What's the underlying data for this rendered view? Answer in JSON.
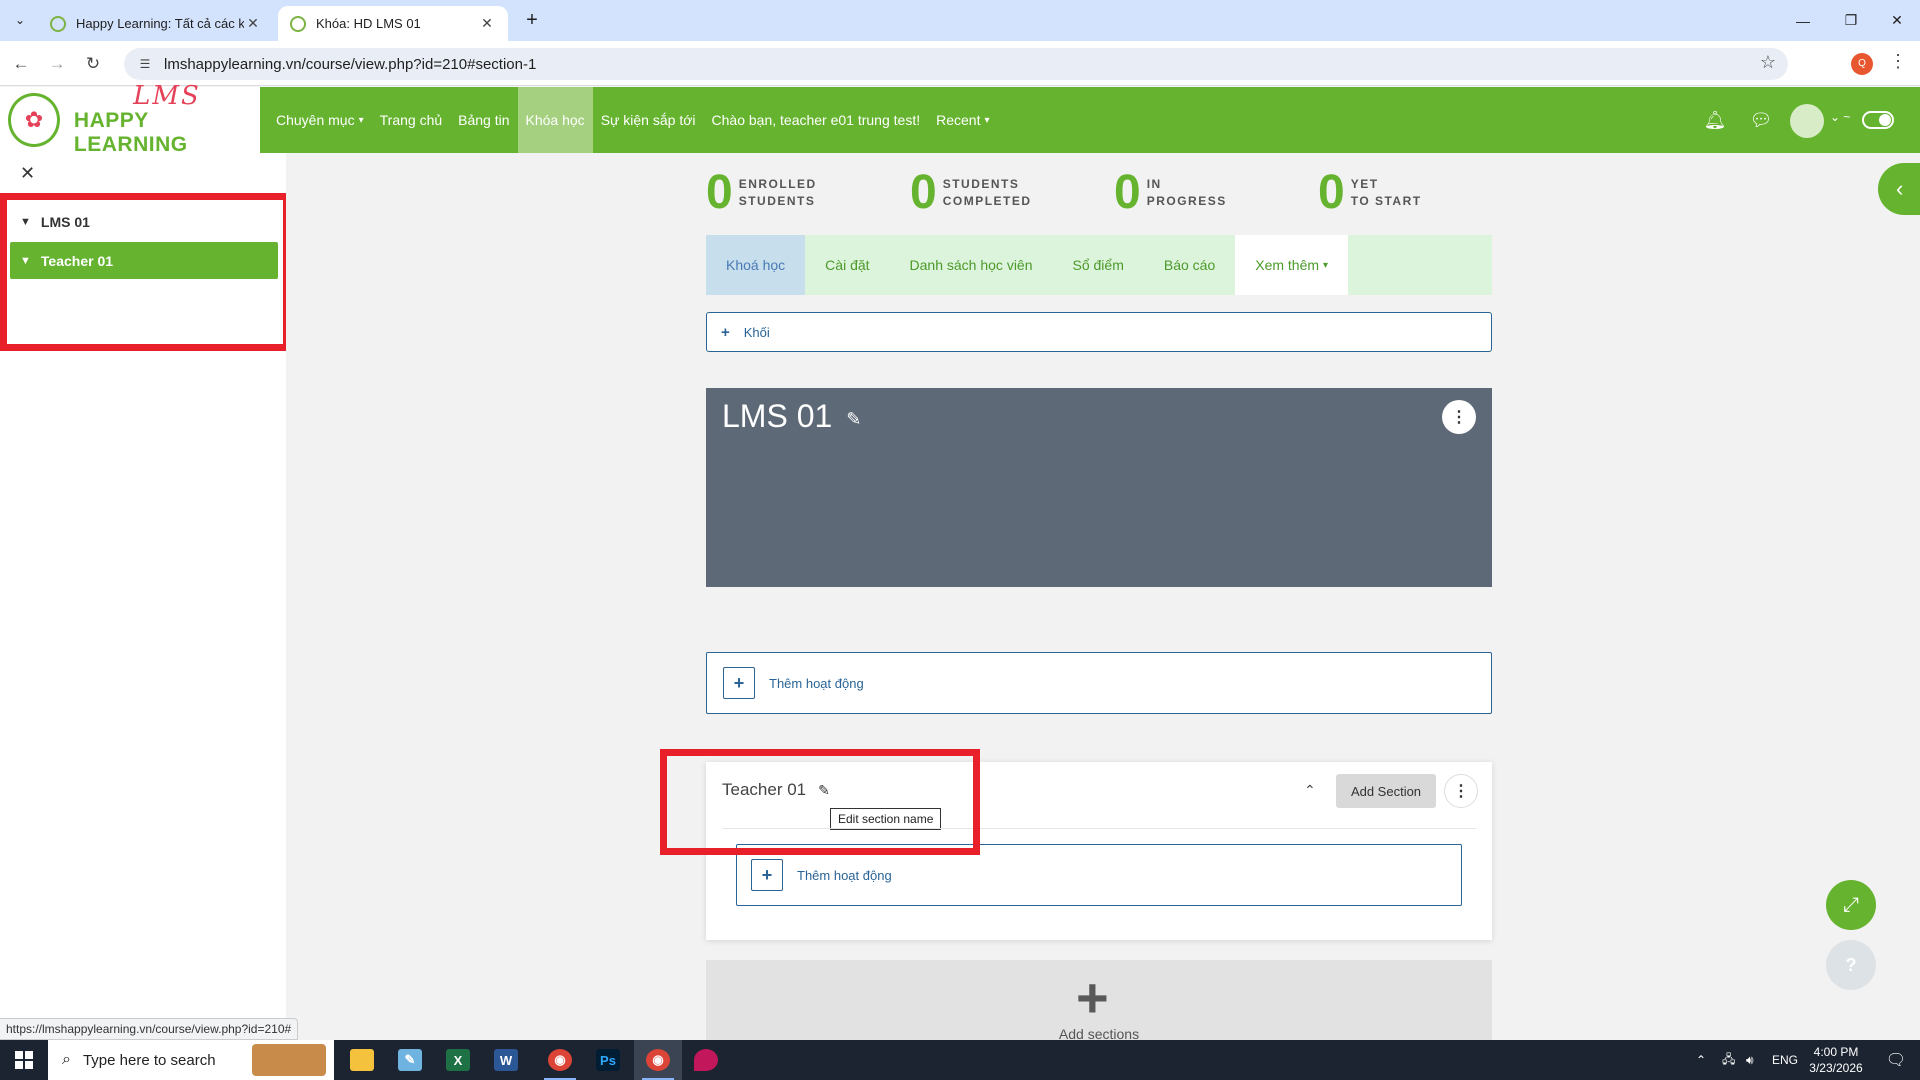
{
  "browser": {
    "tabs": [
      {
        "title": "Happy Learning: Tất cả các khoá",
        "active": false
      },
      {
        "title": "Khóa: HD LMS 01",
        "active": true
      }
    ],
    "url": "lmshappylearning.vn/course/view.php?id=210#section-1",
    "status_url": "https://lmshappylearning.vn/course/view.php?id=210#",
    "profile_initial": "Q"
  },
  "site": {
    "logo_lms": "LMS",
    "logo_name": "HAPPY LEARNING",
    "nav": [
      {
        "label": "Chuyên mục",
        "dropdown": true
      },
      {
        "label": "Trang chủ"
      },
      {
        "label": "Bảng tin"
      },
      {
        "label": "Khóa học",
        "active": true
      },
      {
        "label": "Sự kiện sắp tới"
      },
      {
        "label": "Chào bạn, teacher e01 trung test!"
      },
      {
        "label": "Recent",
        "dropdown": true
      }
    ]
  },
  "drawer": {
    "items": [
      {
        "label": "LMS 01",
        "active": false
      },
      {
        "label": "Teacher 01",
        "active": true
      }
    ]
  },
  "stats": [
    {
      "value": "0",
      "line1": "ENROLLED",
      "line2": "STUDENTS"
    },
    {
      "value": "0",
      "line1": "STUDENTS",
      "line2": "COMPLETED"
    },
    {
      "value": "0",
      "line1": "IN",
      "line2": "PROGRESS"
    },
    {
      "value": "0",
      "line1": "YET",
      "line2": "TO START"
    }
  ],
  "course_nav": [
    {
      "label": "Khoá học",
      "active": true
    },
    {
      "label": "Cài đặt"
    },
    {
      "label": "Danh sách học viên"
    },
    {
      "label": "Sổ điểm"
    },
    {
      "label": "Báo cáo"
    },
    {
      "label": "Xem thêm",
      "dropdown": true
    }
  ],
  "block_add_label": "Khối",
  "section0": {
    "title": "LMS 01",
    "add_activity_label": "Thêm hoạt động"
  },
  "section1": {
    "title": "Teacher 01",
    "tooltip": "Edit section name",
    "add_section_label": "Add Section",
    "add_activity_label": "Thêm hoạt động"
  },
  "add_sections_label": "Add sections",
  "taskbar": {
    "search_placeholder": "Type here to search",
    "language": "ENG",
    "time": "4:00 PM",
    "date": "3/23/2026"
  },
  "colors": {
    "brand_green": "#65b32e",
    "highlight_red": "#e8202a",
    "banner_gray": "#5d6977"
  }
}
